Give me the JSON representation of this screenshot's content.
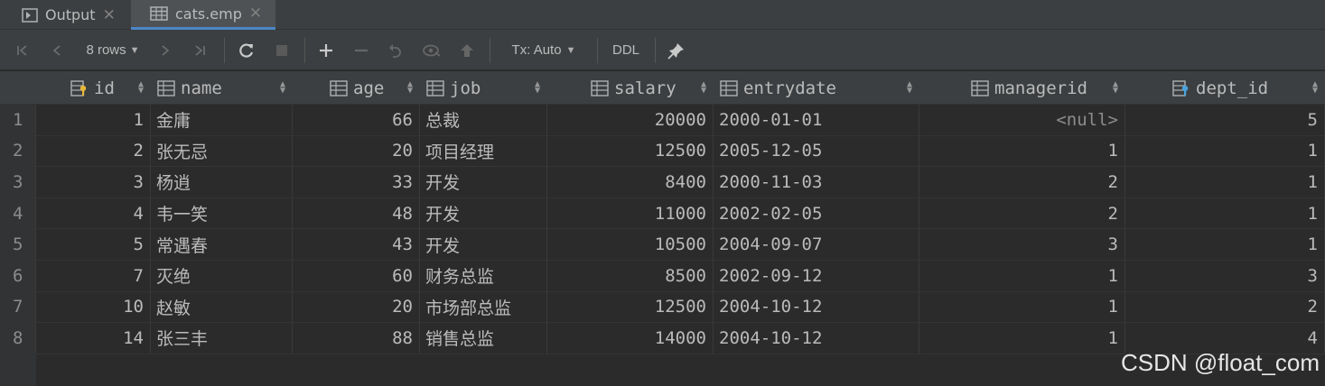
{
  "tabs": [
    {
      "label": "Output",
      "icon": "console-icon",
      "active": false
    },
    {
      "label": "cats.emp",
      "icon": "table-icon",
      "active": true
    }
  ],
  "toolbar": {
    "rows_label": "8 rows",
    "tx_label": "Tx: Auto",
    "ddl_label": "DDL"
  },
  "columns": [
    {
      "name": "id",
      "icon": "primary-key-column-icon"
    },
    {
      "name": "name",
      "icon": "column-icon"
    },
    {
      "name": "age",
      "icon": "column-icon"
    },
    {
      "name": "job",
      "icon": "column-icon"
    },
    {
      "name": "salary",
      "icon": "column-icon"
    },
    {
      "name": "entrydate",
      "icon": "column-icon"
    },
    {
      "name": "managerid",
      "icon": "column-icon"
    },
    {
      "name": "dept_id",
      "icon": "foreign-key-column-icon"
    }
  ],
  "rows": [
    {
      "n": "1",
      "id": "1",
      "name": "金庸",
      "age": "66",
      "job": "总裁",
      "salary": "20000",
      "entrydate": "2000-01-01",
      "managerid": "<null>",
      "dept_id": "5"
    },
    {
      "n": "2",
      "id": "2",
      "name": "张无忌",
      "age": "20",
      "job": "项目经理",
      "salary": "12500",
      "entrydate": "2005-12-05",
      "managerid": "1",
      "dept_id": "1"
    },
    {
      "n": "3",
      "id": "3",
      "name": "杨逍",
      "age": "33",
      "job": "开发",
      "salary": "8400",
      "entrydate": "2000-11-03",
      "managerid": "2",
      "dept_id": "1"
    },
    {
      "n": "4",
      "id": "4",
      "name": "韦一笑",
      "age": "48",
      "job": "开发",
      "salary": "11000",
      "entrydate": "2002-02-05",
      "managerid": "2",
      "dept_id": "1"
    },
    {
      "n": "5",
      "id": "5",
      "name": "常遇春",
      "age": "43",
      "job": "开发",
      "salary": "10500",
      "entrydate": "2004-09-07",
      "managerid": "3",
      "dept_id": "1"
    },
    {
      "n": "6",
      "id": "7",
      "name": "灭绝",
      "age": "60",
      "job": "财务总监",
      "salary": "8500",
      "entrydate": "2002-09-12",
      "managerid": "1",
      "dept_id": "3"
    },
    {
      "n": "7",
      "id": "10",
      "name": "赵敏",
      "age": "20",
      "job": "市场部总监",
      "salary": "12500",
      "entrydate": "2004-10-12",
      "managerid": "1",
      "dept_id": "2"
    },
    {
      "n": "8",
      "id": "14",
      "name": "张三丰",
      "age": "88",
      "job": "销售总监",
      "salary": "14000",
      "entrydate": "2004-10-12",
      "managerid": "1",
      "dept_id": "4"
    }
  ],
  "watermark": "CSDN @float_com"
}
